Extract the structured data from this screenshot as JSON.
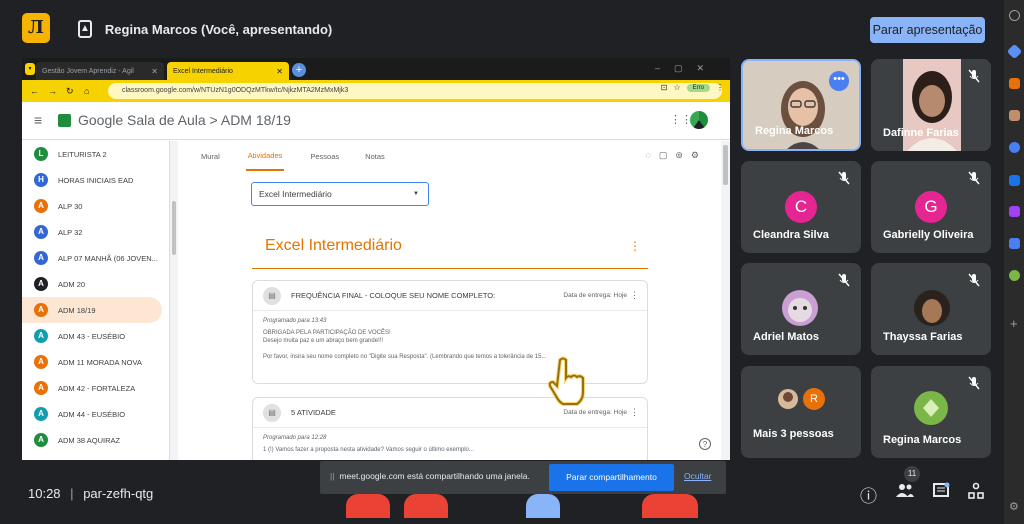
{
  "header": {
    "logo_letter": "Л",
    "presenting_title": "Regina Marcos (Você, apresentando)",
    "stop_button": "Parar apresentação"
  },
  "browser": {
    "tab1": "Gestão Jovem Aprendiz - Agil",
    "tab2": "Excel Intermediário",
    "url": "classroom.google.com/w/NTUzN1g0ODQzMTkw/tc/NjkzMTA2MzMxMjk3",
    "error_pill": "Erro"
  },
  "classroom": {
    "app_name": "Google Sala de Aula",
    "breadcrumb_sep": ">",
    "class_name": "ADM 18/19",
    "tabs": [
      "Mural",
      "Atividades",
      "Pessoas",
      "Notas"
    ],
    "filter_value": "Excel Intermediário",
    "section_title": "Excel Intermediário",
    "sidebar": [
      {
        "letter": "L",
        "label": "LEITURISTA 2",
        "color": "#1e8e3e"
      },
      {
        "letter": "H",
        "label": "HORAS INICIAIS EAD",
        "color": "#3367d6"
      },
      {
        "letter": "A",
        "label": "ALP 30",
        "color": "#e8710a"
      },
      {
        "letter": "A",
        "label": "ALP 32",
        "color": "#3367d6"
      },
      {
        "letter": "A",
        "label": "ALP 07 MANHÃ (06 JOVEN...",
        "color": "#3367d6"
      },
      {
        "letter": "A",
        "label": "ADM 20",
        "color": "#202124"
      },
      {
        "letter": "A",
        "label": "ADM 18/19",
        "color": "#e8710a"
      },
      {
        "letter": "A",
        "label": "ADM 43 - EUSÉBIO",
        "color": "#129eaf"
      },
      {
        "letter": "A",
        "label": "ADM 11 MORADA NOVA",
        "color": "#e8710a"
      },
      {
        "letter": "A",
        "label": "ADM 42 - FORTALEZA",
        "color": "#e8710a"
      },
      {
        "letter": "A",
        "label": "ADM 44 - EUSÉBIO",
        "color": "#129eaf"
      },
      {
        "letter": "A",
        "label": "ADM 38 AQUIRAZ",
        "color": "#1e8e3e"
      }
    ],
    "card1": {
      "title": "FREQUÊNCIA FINAL - COLOQUE SEU NOME COMPLETO:",
      "due": "Data de entrega: Hoje",
      "scheduled": "Programado para 13:43",
      "line1": "OBRIGADA PELA PARTICIPAÇÃO DE VOCÊS!",
      "line2": "Desejo muita paz e um abraço bem grande!!!",
      "line3": "Por favor, insira seu nome completo no \"Digite sua Resposta\". (Lembrando que temos a tolerância de 15..."
    },
    "card2": {
      "title": "5 ATIVIDADE",
      "due": "Data de entrega: Hoje",
      "scheduled": "Programado para 12:28",
      "line1": "1 (!) Vamos fazer a proposta nesta atividade? Vamos seguir o último exemplo..."
    }
  },
  "participants": [
    {
      "name": "Regina Marcos"
    },
    {
      "name": "Dafinne Farias"
    },
    {
      "name": "Cleandra Silva",
      "initial": "C",
      "color": "#e52592"
    },
    {
      "name": "Gabrielly Oliveira",
      "initial": "G",
      "color": "#e52592"
    },
    {
      "name": "Adriel Matos"
    },
    {
      "name": "Thayssa Farias"
    },
    {
      "name": "Mais 3 pessoas",
      "initial": "R",
      "color": "#e8710a"
    },
    {
      "name": "Regina Marcos"
    }
  ],
  "bottom": {
    "time": "10:28",
    "separator": "|",
    "meeting_code": "par-zefh-qtg",
    "participant_count": "11"
  },
  "share_notice": {
    "text": "meet.google.com está compartilhando uma janela.",
    "stop_button": "Parar compartilhamento",
    "hide_link": "Ocultar"
  }
}
